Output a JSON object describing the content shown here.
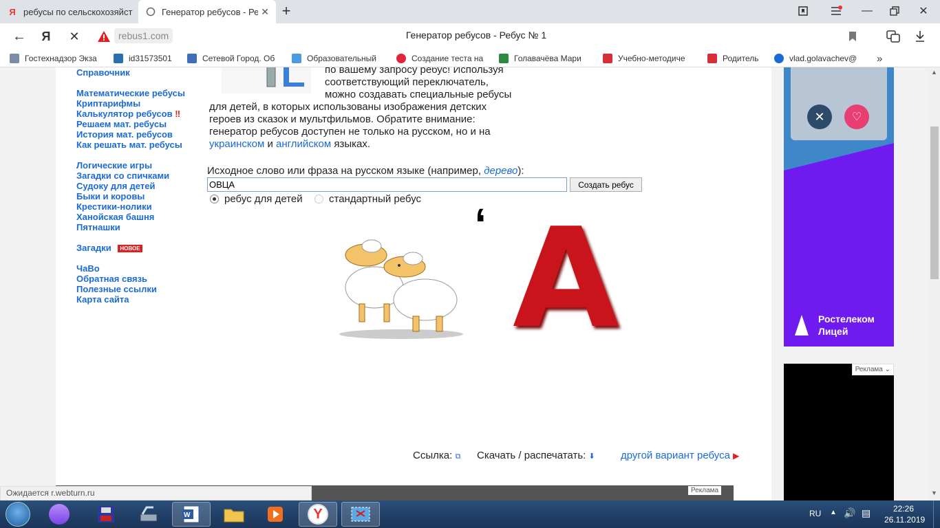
{
  "tabs": [
    {
      "label": "ребусы по сельскохозяйст",
      "icon": "yandex-icon"
    },
    {
      "label": "Генератор ребусов - Ре",
      "icon": "loading-icon"
    }
  ],
  "address": {
    "domain": "rebus1.com",
    "title": "Генератор ребусов - Ребус № 1"
  },
  "bookmarks": [
    {
      "label": "Гостехнадзор Экза",
      "color": "#7a8ca8"
    },
    {
      "label": "id31573501",
      "color": "#2a6fb0"
    },
    {
      "label": "Сетевой Город. Об",
      "color": "#3e6fb8"
    },
    {
      "label": "Образовательный",
      "color": "#4c9be0"
    },
    {
      "label": "Создание теста на",
      "color": "#e0253a"
    },
    {
      "label": "Голавачёва Мари",
      "color": "#2b8a3e"
    },
    {
      "label": "Учебно-методиче",
      "color": "#d62f3a"
    },
    {
      "label": "Родитель",
      "color": "#d62f3a"
    },
    {
      "label": "vlad.golavachev@",
      "color": "#1a6ad6"
    }
  ],
  "sidebar": {
    "top": "Справочник",
    "group1": [
      "Математические ребусы",
      "Криптарифмы",
      "Калькулятор ребусов",
      "Решаем мат. ребусы",
      "История мат. ребусов",
      "Как решать мат. ребусы"
    ],
    "calc_mark": "‼",
    "group2": [
      "Логические игры",
      "Загадки со спичками",
      "Судоку для детей",
      "Быки и коровы",
      "Крестики-нолики",
      "Ханойская башня",
      "Пятнашки"
    ],
    "riddles": "Загадки",
    "new_badge": "НОВОЕ",
    "group3": [
      "ЧаВо",
      "Обратная связь",
      "Полезные ссылки",
      "Карта сайта"
    ]
  },
  "intro": {
    "line1": "по вашему запросу ребус! Используя",
    "line2": "соответствующий переключатель,",
    "line3": "можно создавать специальные ребусы",
    "line4": "для детей, в которых использованы изображения детских",
    "line5": "героев из сказок и мультфильмов. Обратите внимание:",
    "line6": "генератор ребусов доступен не только на русском, но и на",
    "link_ua": "украинском",
    "and": "и",
    "link_en": "английском",
    "tail": "языках."
  },
  "form": {
    "label_pre": "Исходное слово или фраза на русском языке (например, ",
    "label_example": "дерево",
    "label_post": "):",
    "value": "ОВЦА",
    "button": "Создать ребус",
    "radio_kids": "ребус для детей",
    "radio_std": "стандартный ребус"
  },
  "rebus": {
    "comma": ",",
    "letter": "А"
  },
  "footer_links": {
    "link_label": "Ссылка:",
    "download_label": "Скачать / распечатать:",
    "other": "другой вариант ребуса"
  },
  "ads": {
    "brand": "Ростелеком",
    "brand2": "Лицей",
    "ad_label": "Реклама"
  },
  "status": "Ожидается r.webturn.ru",
  "tray": {
    "lang": "RU",
    "time": "22:26",
    "date": "26.11.2019"
  }
}
